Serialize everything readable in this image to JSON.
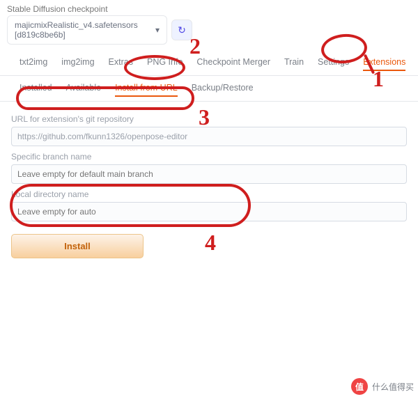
{
  "checkpoint": {
    "label": "Stable Diffusion checkpoint",
    "value": "majicmixRealistic_v4.safetensors [d819c8be6b]"
  },
  "tabs": {
    "items": [
      "txt2img",
      "img2img",
      "Extras",
      "PNG Info",
      "Checkpoint Merger",
      "Train",
      "Settings",
      "Extensions"
    ],
    "active": "Extensions"
  },
  "subtabs": {
    "items": [
      "Installed",
      "Available",
      "Install from URL",
      "Backup/Restore"
    ],
    "active": "Install from URL"
  },
  "form": {
    "url_label": "URL for extension's git repository",
    "url_value": "https://github.com/fkunn1326/openpose-editor",
    "branch_label": "Specific branch name",
    "branch_placeholder": "Leave empty for default main branch",
    "dir_label": "Local directory name",
    "dir_placeholder": "Leave empty for auto",
    "install_label": "Install"
  },
  "annotations": {
    "n1": "1",
    "n2": "2",
    "n3": "3",
    "n4": "4"
  },
  "watermark": {
    "badge": "值",
    "text": "什么值得买"
  }
}
